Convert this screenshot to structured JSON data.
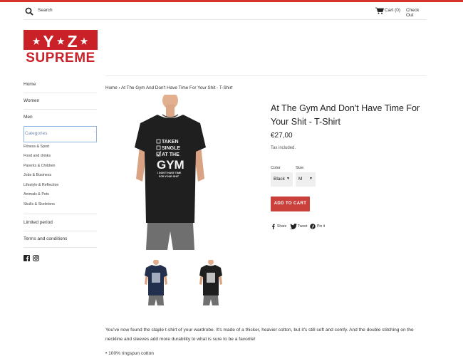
{
  "header": {
    "search_label": "Search",
    "cart_label": "Cart (0)",
    "checkout_label": "Check Out"
  },
  "logo": {
    "top_text_left": "Y",
    "top_text_right": "Z",
    "bottom_text": "SUPREME",
    "brand_color": "#c92127"
  },
  "nav": {
    "home": "Home",
    "women": "Women",
    "men": "Men",
    "categories_label": "Categories",
    "categories": [
      "Fitness & Sport",
      "Food and drinks",
      "Parents & Children",
      "Jobs & Business",
      "Lifestyle & Reflection",
      "Animals & Pets",
      "Skulls & Skeletons"
    ],
    "limited": "Limited period",
    "terms": "Terms and conditions"
  },
  "social_icons": [
    "facebook-icon",
    "instagram-icon"
  ],
  "breadcrumb": {
    "home": "Home",
    "separator": "›",
    "current": "At The Gym And Don't Have Time For Your Shit - T-Shirt"
  },
  "product": {
    "title": "At The Gym And Don't Have Time For Your Shit - T-Shirt",
    "price": "€27,00",
    "tax_note": "Tax included.",
    "color_label": "Color",
    "color_value": "Black",
    "size_label": "Size",
    "size_value": "M",
    "add_to_cart": "ADD TO CART",
    "shirt_text": {
      "line1": "TAKEN",
      "line2": "SINGLE",
      "line3": "AT THE",
      "line4": "GYM",
      "line5": "I DON'T HAVE TIME",
      "line6": "FOR YOUR SHIT"
    },
    "thumbnails": [
      "navy",
      "black"
    ],
    "accent_color": "#c9413a"
  },
  "share": {
    "facebook": "Share",
    "twitter": "Tweet",
    "pinterest": "Pin it"
  },
  "description": {
    "paragraph": "You've now found the staple t-shirt of your wardrobe. It's made of a thicker, heavier cotton, but it's still soft and comfy. And the double stitching on the neckline and sleeves add more durability to what is sure to be a favorite!",
    "bullet1": "• 100% ringspun cotton"
  }
}
